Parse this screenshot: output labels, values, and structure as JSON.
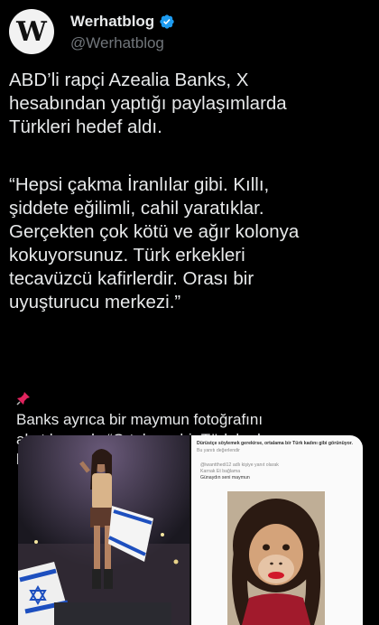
{
  "author": {
    "name": "Werhatblog",
    "handle": "@Werhatblog",
    "avatar_letter": "W",
    "verified": true,
    "verified_color": "#1d9bf0"
  },
  "tweet": {
    "paragraph1": "ABD’li rapçi Azealia Banks, X\nhesabından yaptığı paylaşımlarda\nTürkleri hedef aldı.",
    "paragraph2": "“Hepsi çakma İranlılar gibi. Kıllı,\nşiddete eğilimli, cahil yaratıklar.\nGerçekten çok kötü ve ağır kolonya\nkokuyorsunuz. Türk erkekleri\ntecavüzcü kafirlerdir. Orası bir\nuyuşturucu merkezi.”",
    "note_icon": "pin-icon",
    "note": "Banks ayrıca bir maymun fotoğrafını\nalıntılayarak, “Ortalama bir Türk kadınına\nbenziyor” ifadelerini kullandı."
  },
  "media": {
    "left_image": "concert-performer-with-flag",
    "right_screenshot": {
      "header": "Dürüstçe söylemek gerekirse, ortalama bir Türk kadını gibi görünüyor.",
      "reply_line": "Bu yanıtı değerlendir",
      "quoted_handle": "@iwantthedi12 adlı kişiye yanıt olarak",
      "quoted_meta": "Karnak Et bağlama",
      "quoted_text": "Günaydın seni maymun",
      "image": "monkey-with-wig"
    }
  }
}
